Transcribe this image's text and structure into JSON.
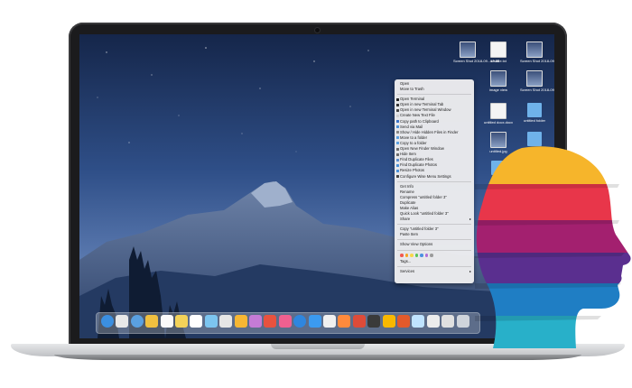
{
  "desktop_icons": [
    {
      "label": "Screen Shot\n2018-09...13.58",
      "kind": "shot"
    },
    {
      "label": "newfile.txt",
      "kind": "doc"
    },
    {
      "label": "Screen Shot\n2018-09...13.40",
      "kind": "shot"
    },
    {
      "label": "image view",
      "kind": "shot"
    },
    {
      "label": "Screen Shot\n2018-09...12.12",
      "kind": "shot"
    },
    {
      "label": "untitled docx.docx",
      "kind": "doc"
    },
    {
      "label": "untitled folder",
      "kind": "folder"
    },
    {
      "label": "untitled.jpg",
      "kind": "shot"
    },
    {
      "label": "data",
      "kind": "folder"
    }
  ],
  "context_menu": {
    "groups": [
      [
        "Open",
        "Move to Trash"
      ],
      [
        "Open Terminal",
        "Open in new Terminal Tab",
        "Open in new Terminal Window",
        "Create New Text File",
        "Copy path to Clipboard",
        "Send via Mail",
        "Show / Hide Hidden Files in Finder",
        "Move to a folder",
        "Copy to a folder",
        "Open New Finder Window",
        "Hide Item",
        "Find Duplicate Files",
        "Find Duplicate Photos",
        "Resize Photos",
        "Configure Wise Menu Settings"
      ],
      [
        "Get Info",
        "Rename",
        "Compress \"untitled folder 3\"",
        "Duplicate",
        "Make Alias",
        "Quick Look \"untitled folder 3\"",
        "Share"
      ],
      [
        "Copy \"untitled folder 3\"",
        "Paste Item"
      ],
      [
        "Show View Options"
      ],
      [
        "Tags..."
      ],
      [
        "Services"
      ]
    ],
    "submenu_items": [
      "Share",
      "Services"
    ],
    "icon_colors": [
      "#222222",
      "#333333",
      "#444444",
      "#d0d0d0",
      "#3b73c8",
      "#4a90d9",
      "#888888",
      "#5aa0e0",
      "#5aa0e0",
      "#6b6b6b",
      "#6b6b6b",
      "#5b8fd0",
      "#4a90d9",
      "#4a90d9",
      "#444444"
    ],
    "tag_colors": [
      "#f25b50",
      "#f5a623",
      "#f8d74a",
      "#5ac55a",
      "#4a90e2",
      "#b06fd8",
      "#9b9b9b"
    ]
  },
  "dock_colors": [
    "#3b8fe0",
    "#e8e8e8",
    "#5aa0e0",
    "#f0c040",
    "#fafafa",
    "#f3d259",
    "#ffffff",
    "#7cc5f0",
    "#e6e6e6",
    "#f7b733",
    "#c57bd6",
    "#e8523e",
    "#f06090",
    "#2f86de",
    "#3b9af0",
    "#f0f0f0",
    "#ff8a3c",
    "#dd4b39",
    "#3a3a3a",
    "#f8b800",
    "#e25a2b",
    "#bfe3ff",
    "#ececec",
    "#e0e0e0",
    "#cfd4db"
  ],
  "brand_colors": [
    "#f6b52b",
    "#e8364a",
    "#a3206f",
    "#5a2f8f",
    "#1f7ec4",
    "#28b0c9"
  ]
}
